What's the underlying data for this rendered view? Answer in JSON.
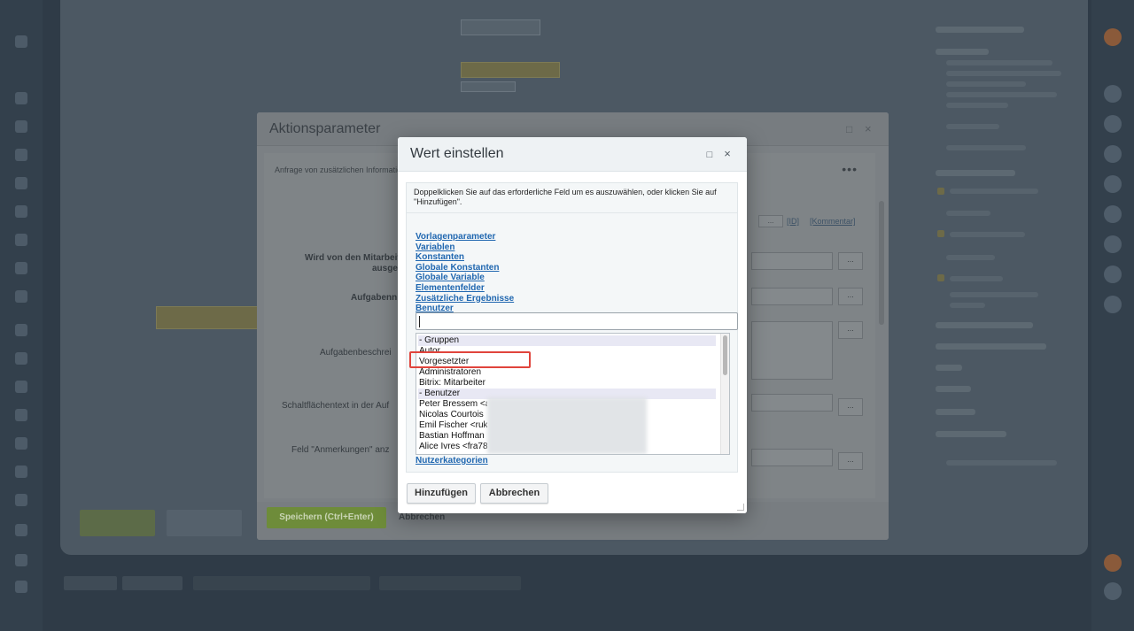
{
  "params_dialog": {
    "title": "Aktionsparameter",
    "intro": "Anfrage von zusätzlichen Informationen",
    "labels": {
      "wird_von": "Wird von den Mitarbeitern",
      "ausge": "ausge",
      "aufgabenname": "Aufgabenn",
      "beschreibung": "Aufgabenbeschrei",
      "schaltflaeche": "Schaltflächentext in der Auf",
      "anmerkungen": "Feld \"Anmerkungen\" anz"
    },
    "id_link": "[ID]",
    "kommentar_link": "[Kommentar]",
    "dots": "...",
    "save_label": "Speichern (Ctrl+Enter)",
    "cancel_label": "Abbrechen"
  },
  "value_dialog": {
    "title": "Wert einstellen",
    "instruction": "Doppelklicken Sie auf das erforderliche Feld um es auszuwählen, oder klicken Sie auf \"Hinzufügen\".",
    "links": [
      "Vorlagenparameter",
      "Variablen",
      "Konstanten",
      "Globale Konstanten",
      "Globale Variable",
      "Elementenfelder",
      "Zusätzliche Ergebnisse",
      "Benutzer"
    ],
    "search_value": "",
    "options": [
      {
        "label": "- Gruppen",
        "group": true
      },
      {
        "label": "Autor",
        "group": false
      },
      {
        "label": "Vorgesetzter",
        "group": false,
        "highlighted": true
      },
      {
        "label": "Administratoren",
        "group": false
      },
      {
        "label": "Bitrix: Mitarbeiter",
        "group": false
      },
      {
        "label": "- Benutzer",
        "group": true
      },
      {
        "label": "Peter Bressem <a",
        "group": false
      },
      {
        "label": "Nicolas Courtois",
        "group": false
      },
      {
        "label": "Emil Fischer <ruk",
        "group": false
      },
      {
        "label": "Bastian Hoffman",
        "group": false
      },
      {
        "label": "Alice Ivres <fra78",
        "group": false
      }
    ],
    "bottom_link": "Nutzerkategorien",
    "add_label": "Hinzufügen",
    "cancel_label": "Abbrechen"
  }
}
